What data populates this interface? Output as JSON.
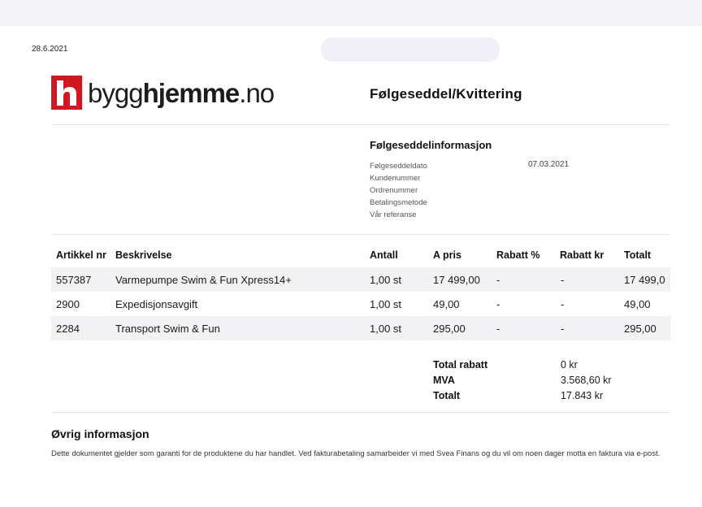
{
  "header": {
    "print_date": "28.6.2021",
    "logo": {
      "text_light": "bygg",
      "text_bold": "hjemme",
      "text_tld": ".no",
      "icon": "h-logo-icon",
      "brand_color": "#d7161f"
    },
    "title": "Følgeseddel/Kvittering"
  },
  "info": {
    "heading": "Følgeseddelinformasjon",
    "labels": [
      "Følgeseddeldato",
      "Kundenummer",
      "Ordrenummer",
      "Betalingsmetode",
      "Vår referanse"
    ],
    "date_value": "07.03.2021"
  },
  "table": {
    "columns": [
      "Artikkel nr",
      "Beskrivelse",
      "Antall",
      "A pris",
      "Rabatt %",
      "Rabatt kr",
      "Totalt"
    ],
    "rows": [
      [
        "557387",
        "Varmepumpe Swim & Fun Xpress14+",
        "1,00 st",
        "17 499,00",
        "-",
        "-",
        "17 499,0"
      ],
      [
        "2900",
        "Expedisjonsavgift",
        "1,00 st",
        "49,00",
        "-",
        "-",
        "49,00"
      ],
      [
        "2284",
        "Transport Swim & Fun",
        "1,00 st",
        "295,00",
        "-",
        "-",
        "295,00"
      ]
    ]
  },
  "summary": {
    "labels": [
      "Total rabatt",
      "MVA",
      "Totalt"
    ],
    "values": [
      "0 kr",
      "3.568,60 kr",
      "17.843 kr"
    ]
  },
  "other": {
    "heading": "Øvrig informasjon",
    "text": "Dette dokumentet gjelder som garanti for de produktene du har handlet. Ved fakturabetaling samarbeider vi med Svea Finans og du vil om noen dager motta en faktura via e-post."
  }
}
